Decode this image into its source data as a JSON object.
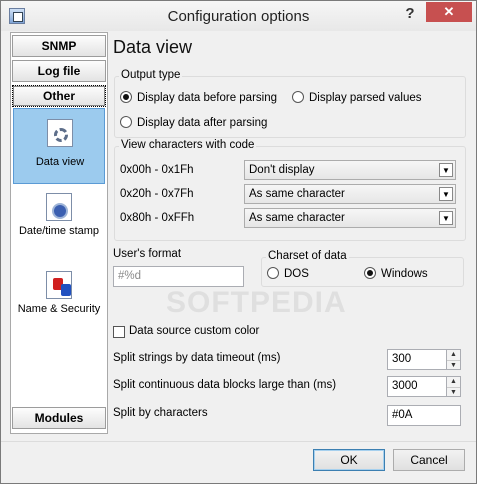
{
  "window": {
    "title": "Configuration options",
    "help_glyph": "?",
    "close_glyph": "✕"
  },
  "sidebar": {
    "buttons": [
      {
        "label": "SNMP"
      },
      {
        "label": "Log file"
      },
      {
        "label": "Other"
      },
      {
        "label": "Modules"
      }
    ],
    "items": [
      {
        "label": "Data view",
        "icon": "gear-document-icon"
      },
      {
        "label": "Date/time stamp",
        "icon": "clock-document-icon"
      },
      {
        "label": "Name & Security",
        "icon": "security-document-icon"
      }
    ]
  },
  "main": {
    "title": "Data view",
    "output_type": {
      "legend": "Output type",
      "options": [
        {
          "label": "Display data before parsing",
          "checked": true
        },
        {
          "label": "Display parsed values",
          "checked": false
        },
        {
          "label": "Display data after parsing",
          "checked": false
        }
      ]
    },
    "view_chars": {
      "legend": "View characters with code",
      "rows": [
        {
          "range": "0x00h - 0x1Fh",
          "value": "Don't display"
        },
        {
          "range": "0x20h - 0x7Fh",
          "value": "As same character"
        },
        {
          "range": "0x80h - 0xFFh",
          "value": "As same character"
        }
      ]
    },
    "users_format": {
      "label": "User's format",
      "value": "#%d"
    },
    "charset": {
      "legend": "Charset of data",
      "options": [
        {
          "label": "DOS",
          "checked": false
        },
        {
          "label": "Windows",
          "checked": true
        }
      ]
    },
    "custom_color": {
      "label": "Data source custom color",
      "checked": false
    },
    "split_timeout": {
      "label": "Split strings by data timeout (ms)",
      "value": "300"
    },
    "split_blocks": {
      "label": "Split continuous data blocks large than (ms)",
      "value": "3000"
    },
    "split_chars": {
      "label": "Split by characters",
      "value": "#0A"
    }
  },
  "footer": {
    "ok": "OK",
    "cancel": "Cancel"
  },
  "watermark": "SOFTPEDIA"
}
